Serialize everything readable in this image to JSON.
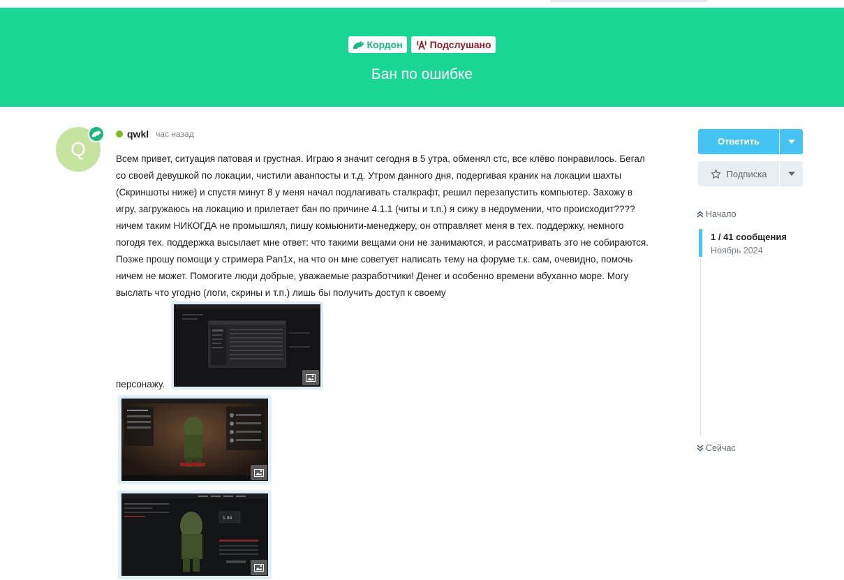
{
  "colors": {
    "hero_bg": "#1ad695",
    "accent_blue": "#45c3f3",
    "tag_kordon": "#1ab87f",
    "tag_podslushano": "#8e1f27",
    "online": "#7cbc1e",
    "avatar_bg": "#c6e4a0"
  },
  "topic": {
    "tags": [
      {
        "label": "Кордон",
        "icon": "frog-icon"
      },
      {
        "label": "Подслушано",
        "icon": "broadcast-icon"
      }
    ],
    "title": "Бан по ошибке"
  },
  "post": {
    "avatar_letter": "Q",
    "avatar_badge_icon": "frog-icon",
    "username": "qwkl",
    "time": "час назад",
    "body": "Всем привет, ситуация патовая и грустная. Играю я значит сегодня в 5 утра, обменял стс, все клёво понравилось. Бегал со своей девушкой по локации, чистили аванпосты и т.д. Утром данного дня, подергивая краник на локации шахты (Скриншоты ниже) и спустя минут 8 у меня начал подлагивать сталкрафт, решил перезапустить компьютер. Захожу в игру, загружаюсь на локацию и прилетает бан по причине 4.1.1 (читы и т.п.) я сижу в недоумении, что происходит???? ничем таким НИКОГДА не промышлял, пишу комьюнити-менеджеру, он отправляет меня в тех. поддержку, немного погодя тех. поддержка высылает мне ответ: что такими вещами они не занимаются, и рассматривать это не собираются. Позже прошу помощи у стримера Pan1x, на что он мне советует написать тему на форуме т.к. сам, очевидно, помочь ничем не может. Помогите люди добрые, уважаемые разработчики! Денег и особенно времени вбуханно море. Могу выслать что угодно (логи, скрины и т.п.) лишь бы получить доступ к своему",
    "body_end": "персонажу.",
    "image_inline_text": "1.04"
  },
  "sidebar": {
    "reply_label": "Ответить",
    "subscribe_label": "Подписка",
    "start_label": "Начало",
    "now_label": "Сейчас",
    "timeline_count": "1 / 41 сообщения",
    "timeline_date": "Ноябрь 2024"
  }
}
